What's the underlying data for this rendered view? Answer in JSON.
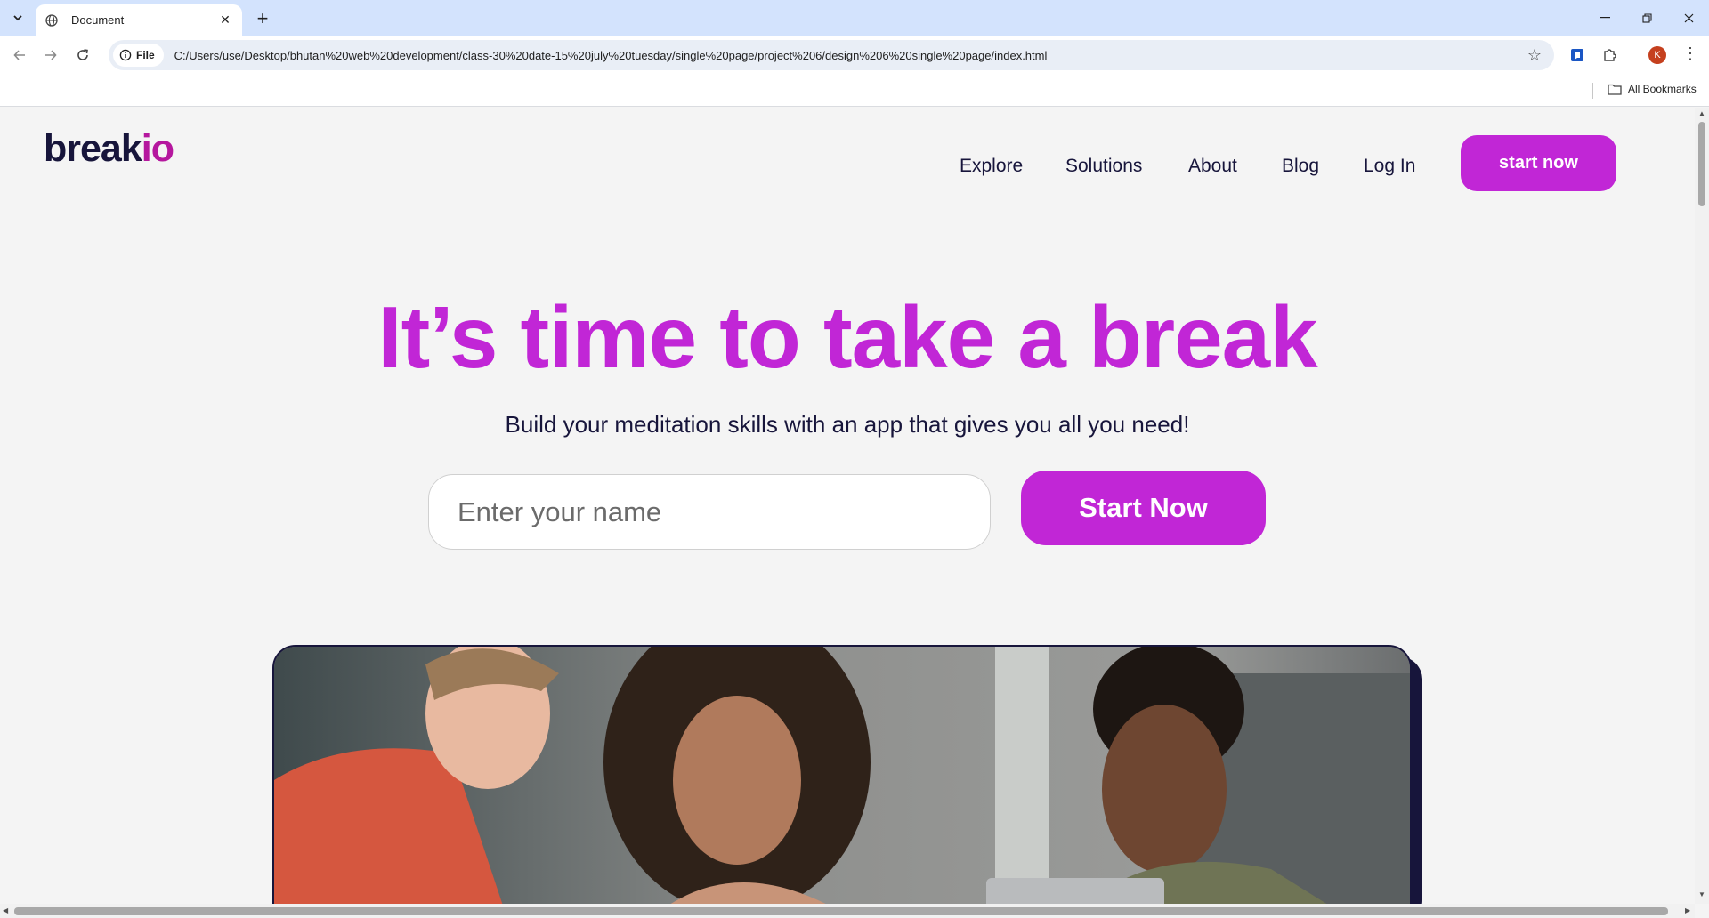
{
  "browser": {
    "tab_title": "Document",
    "url_chip": "File",
    "url": "C:/Users/use/Desktop/bhutan%20web%20development/class-30%20date-15%20july%20tuesday/single%20page/project%206/design%206%20single%20page/index.html",
    "profile_initial": "K",
    "bookmarks_label": "All Bookmarks"
  },
  "site": {
    "logo_part1": "break",
    "logo_part2": "io",
    "nav": [
      "Explore",
      "Solutions",
      "About",
      "Blog",
      "Log In"
    ],
    "cta_top": "start now",
    "hero_title": "It’s time to take a break",
    "hero_subtitle": "Build your meditation skills with an app that gives you all you need!",
    "name_placeholder": "Enter your name",
    "cta_hero": "Start Now"
  },
  "colors": {
    "accent": "#c126d6",
    "dark": "#17153b",
    "background": "#f4f4f4"
  }
}
